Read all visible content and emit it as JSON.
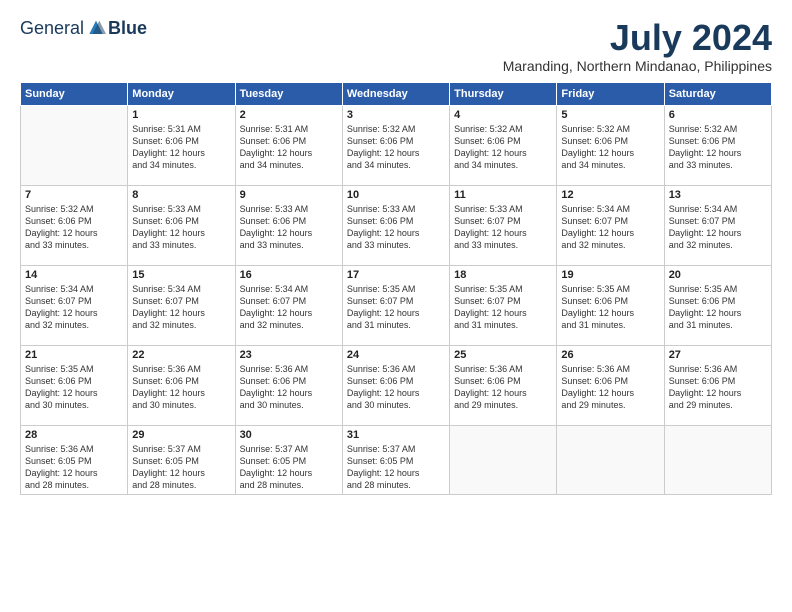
{
  "header": {
    "logo_general": "General",
    "logo_blue": "Blue",
    "month_title": "July 2024",
    "location": "Maranding, Northern Mindanao, Philippines"
  },
  "calendar": {
    "days_of_week": [
      "Sunday",
      "Monday",
      "Tuesday",
      "Wednesday",
      "Thursday",
      "Friday",
      "Saturday"
    ],
    "weeks": [
      [
        {
          "day": "",
          "detail": ""
        },
        {
          "day": "1",
          "detail": "Sunrise: 5:31 AM\nSunset: 6:06 PM\nDaylight: 12 hours\nand 34 minutes."
        },
        {
          "day": "2",
          "detail": "Sunrise: 5:31 AM\nSunset: 6:06 PM\nDaylight: 12 hours\nand 34 minutes."
        },
        {
          "day": "3",
          "detail": "Sunrise: 5:32 AM\nSunset: 6:06 PM\nDaylight: 12 hours\nand 34 minutes."
        },
        {
          "day": "4",
          "detail": "Sunrise: 5:32 AM\nSunset: 6:06 PM\nDaylight: 12 hours\nand 34 minutes."
        },
        {
          "day": "5",
          "detail": "Sunrise: 5:32 AM\nSunset: 6:06 PM\nDaylight: 12 hours\nand 34 minutes."
        },
        {
          "day": "6",
          "detail": "Sunrise: 5:32 AM\nSunset: 6:06 PM\nDaylight: 12 hours\nand 33 minutes."
        }
      ],
      [
        {
          "day": "7",
          "detail": "Sunrise: 5:32 AM\nSunset: 6:06 PM\nDaylight: 12 hours\nand 33 minutes."
        },
        {
          "day": "8",
          "detail": "Sunrise: 5:33 AM\nSunset: 6:06 PM\nDaylight: 12 hours\nand 33 minutes."
        },
        {
          "day": "9",
          "detail": "Sunrise: 5:33 AM\nSunset: 6:06 PM\nDaylight: 12 hours\nand 33 minutes."
        },
        {
          "day": "10",
          "detail": "Sunrise: 5:33 AM\nSunset: 6:06 PM\nDaylight: 12 hours\nand 33 minutes."
        },
        {
          "day": "11",
          "detail": "Sunrise: 5:33 AM\nSunset: 6:07 PM\nDaylight: 12 hours\nand 33 minutes."
        },
        {
          "day": "12",
          "detail": "Sunrise: 5:34 AM\nSunset: 6:07 PM\nDaylight: 12 hours\nand 32 minutes."
        },
        {
          "day": "13",
          "detail": "Sunrise: 5:34 AM\nSunset: 6:07 PM\nDaylight: 12 hours\nand 32 minutes."
        }
      ],
      [
        {
          "day": "14",
          "detail": "Sunrise: 5:34 AM\nSunset: 6:07 PM\nDaylight: 12 hours\nand 32 minutes."
        },
        {
          "day": "15",
          "detail": "Sunrise: 5:34 AM\nSunset: 6:07 PM\nDaylight: 12 hours\nand 32 minutes."
        },
        {
          "day": "16",
          "detail": "Sunrise: 5:34 AM\nSunset: 6:07 PM\nDaylight: 12 hours\nand 32 minutes."
        },
        {
          "day": "17",
          "detail": "Sunrise: 5:35 AM\nSunset: 6:07 PM\nDaylight: 12 hours\nand 31 minutes."
        },
        {
          "day": "18",
          "detail": "Sunrise: 5:35 AM\nSunset: 6:07 PM\nDaylight: 12 hours\nand 31 minutes."
        },
        {
          "day": "19",
          "detail": "Sunrise: 5:35 AM\nSunset: 6:06 PM\nDaylight: 12 hours\nand 31 minutes."
        },
        {
          "day": "20",
          "detail": "Sunrise: 5:35 AM\nSunset: 6:06 PM\nDaylight: 12 hours\nand 31 minutes."
        }
      ],
      [
        {
          "day": "21",
          "detail": "Sunrise: 5:35 AM\nSunset: 6:06 PM\nDaylight: 12 hours\nand 30 minutes."
        },
        {
          "day": "22",
          "detail": "Sunrise: 5:36 AM\nSunset: 6:06 PM\nDaylight: 12 hours\nand 30 minutes."
        },
        {
          "day": "23",
          "detail": "Sunrise: 5:36 AM\nSunset: 6:06 PM\nDaylight: 12 hours\nand 30 minutes."
        },
        {
          "day": "24",
          "detail": "Sunrise: 5:36 AM\nSunset: 6:06 PM\nDaylight: 12 hours\nand 30 minutes."
        },
        {
          "day": "25",
          "detail": "Sunrise: 5:36 AM\nSunset: 6:06 PM\nDaylight: 12 hours\nand 29 minutes."
        },
        {
          "day": "26",
          "detail": "Sunrise: 5:36 AM\nSunset: 6:06 PM\nDaylight: 12 hours\nand 29 minutes."
        },
        {
          "day": "27",
          "detail": "Sunrise: 5:36 AM\nSunset: 6:06 PM\nDaylight: 12 hours\nand 29 minutes."
        }
      ],
      [
        {
          "day": "28",
          "detail": "Sunrise: 5:36 AM\nSunset: 6:05 PM\nDaylight: 12 hours\nand 28 minutes."
        },
        {
          "day": "29",
          "detail": "Sunrise: 5:37 AM\nSunset: 6:05 PM\nDaylight: 12 hours\nand 28 minutes."
        },
        {
          "day": "30",
          "detail": "Sunrise: 5:37 AM\nSunset: 6:05 PM\nDaylight: 12 hours\nand 28 minutes."
        },
        {
          "day": "31",
          "detail": "Sunrise: 5:37 AM\nSunset: 6:05 PM\nDaylight: 12 hours\nand 28 minutes."
        },
        {
          "day": "",
          "detail": ""
        },
        {
          "day": "",
          "detail": ""
        },
        {
          "day": "",
          "detail": ""
        }
      ]
    ]
  }
}
